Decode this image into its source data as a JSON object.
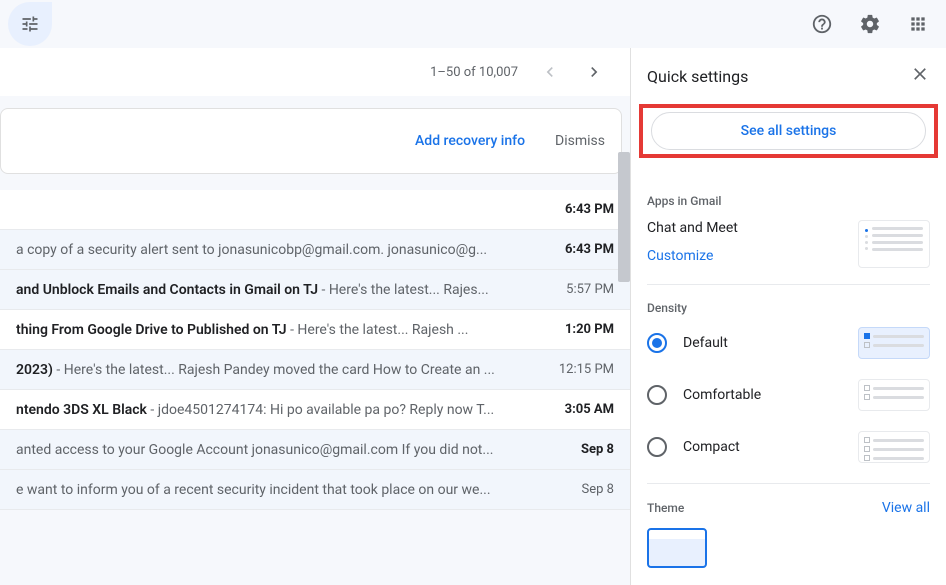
{
  "pagination": {
    "text": "1–50 of 10,007"
  },
  "banner": {
    "action": "Add recovery info",
    "dismiss": "Dismiss"
  },
  "emails": [
    {
      "subject": "",
      "preview": "",
      "time": "6:43 PM",
      "unread": true,
      "timeBold": true
    },
    {
      "subject": "",
      "preview": "a copy of a security alert sent to jonasunicobp@gmail.com. jonasunico@g...",
      "time": "6:43 PM",
      "unread": false,
      "timeBold": true
    },
    {
      "subject": " and Unblock Emails and Contacts in Gmail on TJ",
      "preview": " - Here's the latest... Rajes...",
      "time": "5:57 PM",
      "unread": false,
      "timeBold": false
    },
    {
      "subject": "thing From Google Drive to Published on TJ",
      "preview": " - Here's the latest... Rajesh ...",
      "time": "1:20 PM",
      "unread": true,
      "timeBold": true
    },
    {
      "subject": "2023)",
      "preview": " - Here's the latest... Rajesh Pandey moved the card How to Create an ...",
      "time": "12:15 PM",
      "unread": false,
      "timeBold": false
    },
    {
      "subject": "ntendo 3DS XL Black",
      "preview": " - jdoe4501274174: Hi po available pa po? Reply now T...",
      "time": "3:05 AM",
      "unread": true,
      "timeBold": true
    },
    {
      "subject": "",
      "preview": "anted access to your Google Account jonasunico@gmail.com If you did not...",
      "time": "Sep 8",
      "unread": false,
      "timeBold": true
    },
    {
      "subject": "",
      "preview": "e want to inform you of a recent security incident that took place on our we...",
      "time": "Sep 8",
      "unread": false,
      "timeBold": false
    }
  ],
  "quickSettings": {
    "title": "Quick settings",
    "seeAll": "See all settings",
    "apps": {
      "sectionTitle": "Apps in Gmail",
      "label": "Chat and Meet",
      "customize": "Customize"
    },
    "density": {
      "sectionTitle": "Density",
      "options": [
        {
          "label": "Default",
          "selected": true
        },
        {
          "label": "Comfortable",
          "selected": false
        },
        {
          "label": "Compact",
          "selected": false
        }
      ]
    },
    "theme": {
      "sectionTitle": "Theme",
      "viewAll": "View all"
    }
  }
}
